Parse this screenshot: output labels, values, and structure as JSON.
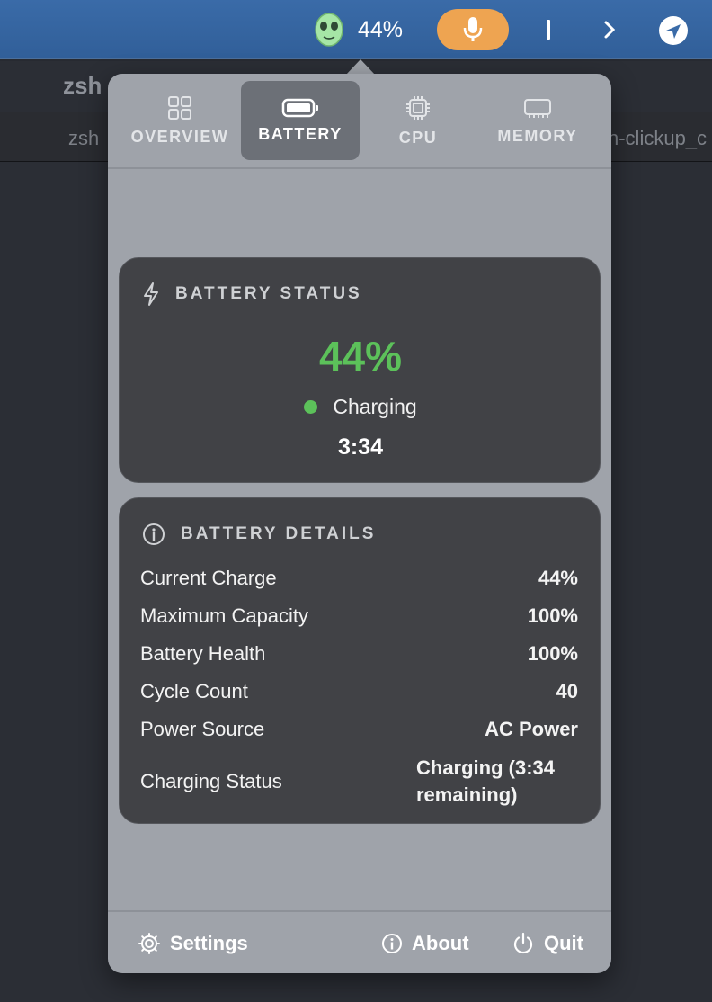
{
  "menubar": {
    "battery_percent": "44%",
    "icons": [
      "alien-face-icon",
      "microphone-icon",
      "text-cursor-icon",
      "chevron-right-icon",
      "location-arrow-icon"
    ],
    "mic_color": "#eea451"
  },
  "terminal": {
    "title": "zsh",
    "tab_left": "zsh",
    "tab_right": "n-clickup_c"
  },
  "popover": {
    "tabs": [
      {
        "label": "OVERVIEW",
        "icon": "grid-icon"
      },
      {
        "label": "BATTERY",
        "icon": "battery-icon",
        "active": true
      },
      {
        "label": "CPU",
        "icon": "cpu-chip-icon"
      },
      {
        "label": "MEMORY",
        "icon": "memory-icon"
      }
    ],
    "status": {
      "header": "BATTERY STATUS",
      "percent": "44%",
      "state": "Charging",
      "time": "3:34",
      "accent_color": "#5cc15a"
    },
    "details": {
      "header": "BATTERY DETAILS",
      "rows": [
        {
          "label": "Current Charge",
          "value": "44%"
        },
        {
          "label": "Maximum Capacity",
          "value": "100%"
        },
        {
          "label": "Battery Health",
          "value": "100%"
        },
        {
          "label": "Cycle Count",
          "value": "40"
        },
        {
          "label": "Power Source",
          "value": "AC Power"
        },
        {
          "label": "Charging Status",
          "value": "Charging (3:34 remaining)"
        }
      ]
    },
    "footer": {
      "settings": "Settings",
      "about": "About",
      "quit": "Quit"
    }
  }
}
